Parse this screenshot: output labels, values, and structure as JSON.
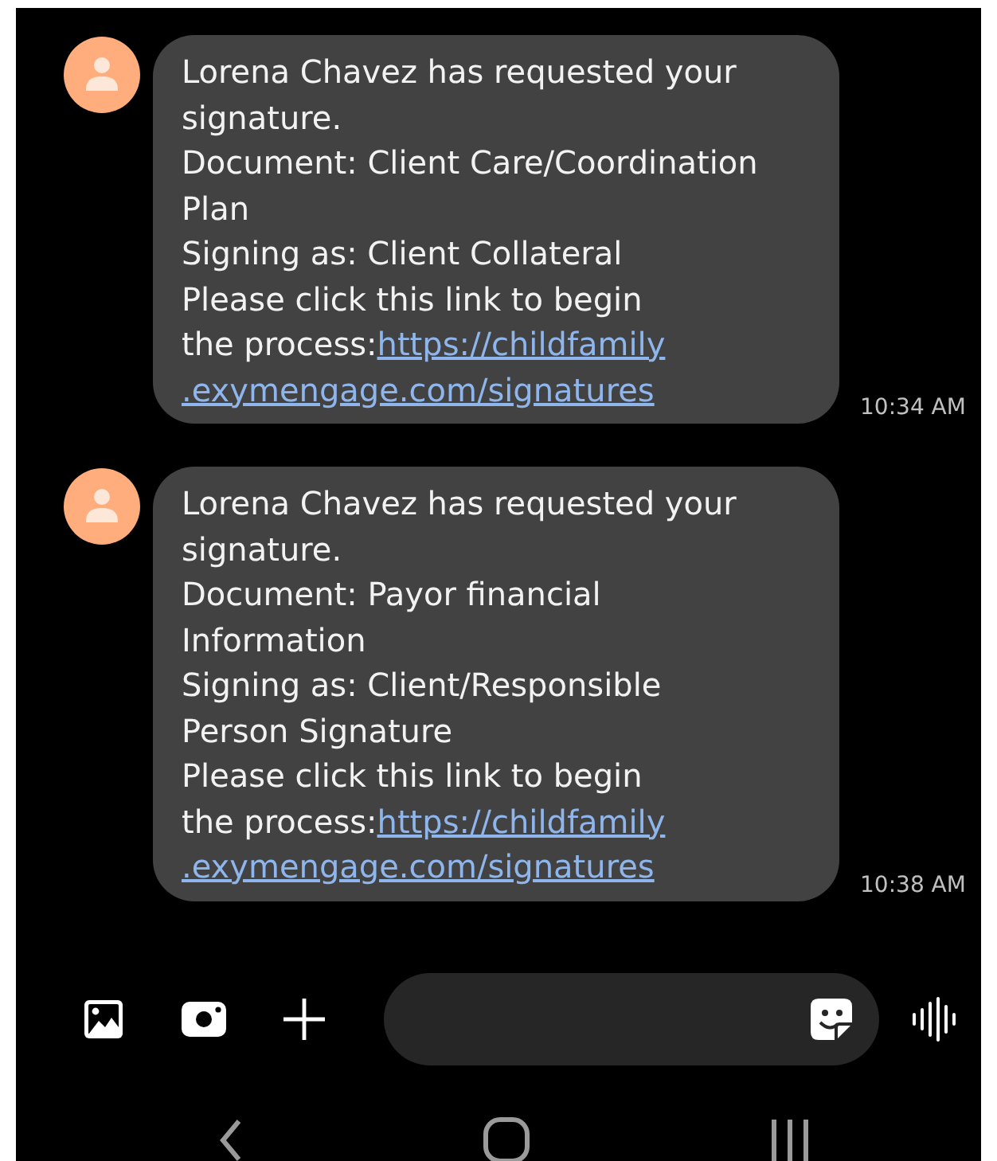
{
  "messages": [
    {
      "lines": [
        "Lorena Chavez has requested your",
        "signature.",
        "Document: Client Care/Coordination",
        "Plan",
        "Signing as: Client Collateral",
        "Please click this link to begin"
      ],
      "link_prefix": "the process:",
      "link_lines": [
        "https://childfamily",
        ".exymengage.com/signatures"
      ],
      "time": "10:34 AM"
    },
    {
      "lines": [
        "Lorena Chavez has requested your",
        "signature.",
        "Document: Payor financial",
        "Information",
        "Signing as: Client/Responsible",
        "Person Signature",
        "Please click this link to begin"
      ],
      "link_prefix": "the process:",
      "link_lines": [
        "https://childfamily",
        ".exymengage.com/signatures"
      ],
      "time": "10:38 AM"
    }
  ]
}
